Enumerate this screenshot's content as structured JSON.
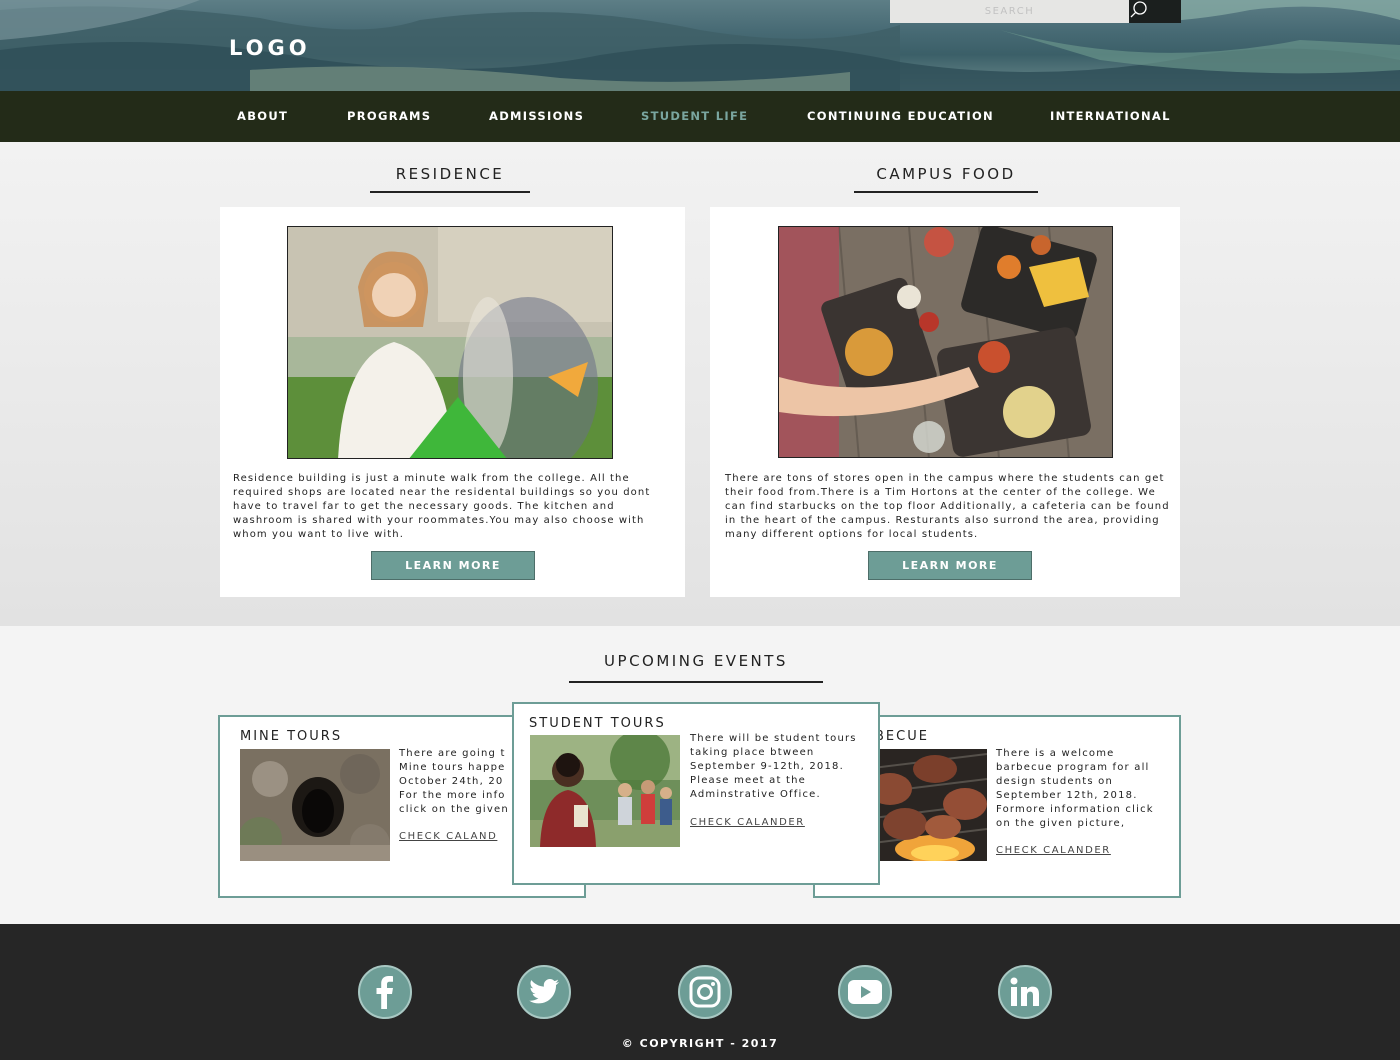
{
  "header": {
    "logo": "LOGO",
    "search_placeholder": "SEARCH"
  },
  "nav": {
    "items": [
      {
        "label": "ABOUT"
      },
      {
        "label": "PROGRAMS"
      },
      {
        "label": "ADMISSIONS"
      },
      {
        "label": "STUDENT LIFE"
      },
      {
        "label": "CONTINUING EDUCATION"
      },
      {
        "label": "INTERNATIONAL"
      }
    ],
    "active_color": "#7aa6a0",
    "background": "#232b18"
  },
  "sections": {
    "residence": {
      "title": "RESIDENCE",
      "text": "Residence building is just a minute walk from the college. All the required shops are located near the residental buildings so you dont have to travel far to get the necessary goods. The kitchen and washroom is  shared with your roommates.You may also choose with whom you want to live with.",
      "button": "LEARN MORE"
    },
    "campus_food": {
      "title": "CAMPUS FOOD",
      "text": "There are tons of stores open in the campus where the students can get their food from.There is a Tim Hortons at the center of the college. We can find starbucks on the top floor Additionally, a cafeteria can be found in the heart of the campus. Resturants also surrond the area, providing many different options for local students.",
      "button": "LEARN MORE"
    }
  },
  "events": {
    "title": "UPCOMING EVENTS",
    "items": [
      {
        "title": "MINE TOURS",
        "text": "There are going t Mine tours happe October 24th, 20 For the more info click on the given",
        "link": "CHECK CALAND"
      },
      {
        "title": "STUDENT TOURS",
        "text": "There will be student tours taking place btween September 9-12th, 2018. Please meet at the Adminstrative Office.",
        "link": "CHECK CALANDER"
      },
      {
        "title": "BECUE",
        "text": "There is a welcome barbecue program for all design students on September 12th, 2018. Formore information click on the given picture,",
        "link": "CHECK CALANDER"
      }
    ],
    "accent": "#6d9d96"
  },
  "footer": {
    "social": [
      "facebook-icon",
      "twitter-icon",
      "instagram-icon",
      "youtube-icon",
      "linkedin-icon"
    ],
    "copyright": "COPYRIGHT - 2017"
  }
}
